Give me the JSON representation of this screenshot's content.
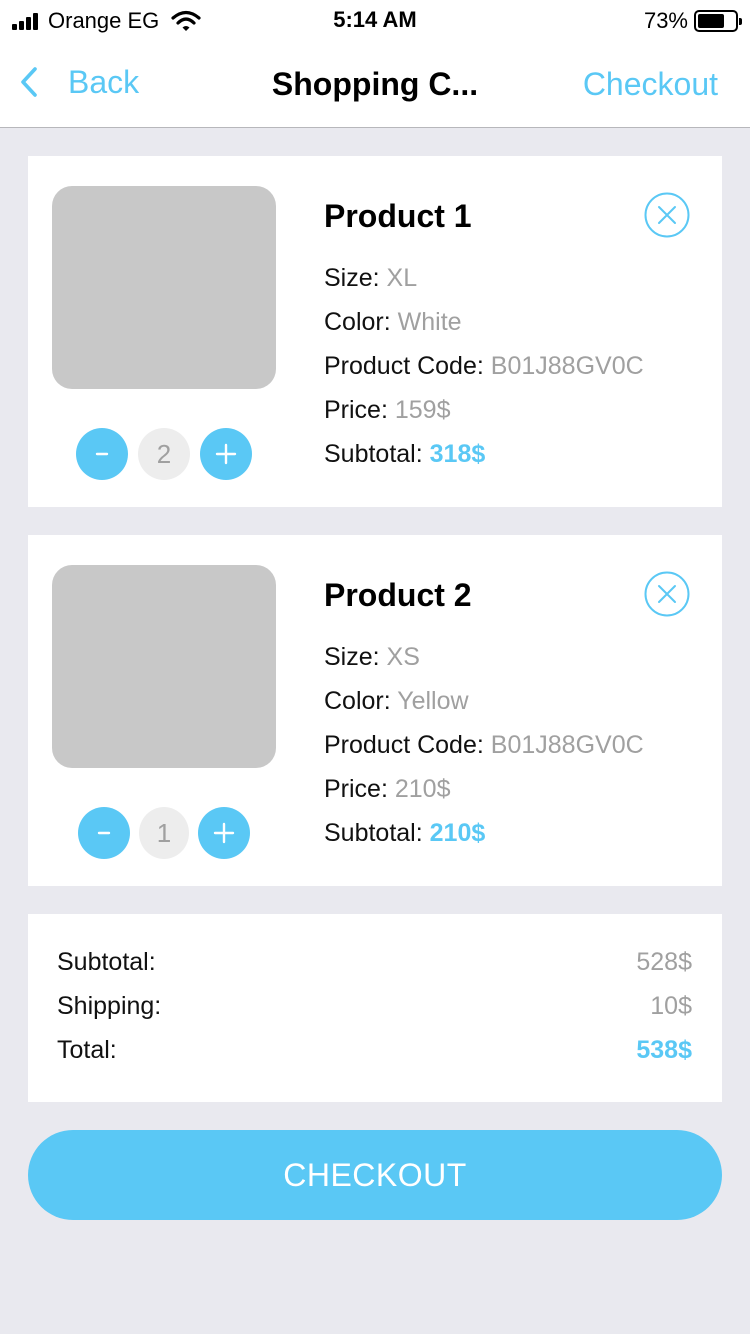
{
  "colors": {
    "accent": "#5ac8f5",
    "background": "#e9e9ef",
    "muted_text": "#a0a0a0",
    "image_placeholder": "#c8c8c8"
  },
  "status_bar": {
    "carrier": "Orange EG",
    "time": "5:14 AM",
    "battery_percent": "73%",
    "battery_level": 0.73,
    "icons": [
      "signal-icon",
      "wifi-icon",
      "battery-icon"
    ]
  },
  "nav": {
    "back_label": "Back",
    "title": "Shopping C...",
    "checkout_label": "Checkout"
  },
  "products": [
    {
      "name": "Product 1",
      "quantity": "2",
      "size_label": "Size:",
      "size": "XL",
      "color_label": "Color:",
      "color": "White",
      "code_label": "Product Code:",
      "code": "B01J88GV0C",
      "price_label": "Price:",
      "price": "159$",
      "subtotal_label": "Subtotal:",
      "subtotal": "318$"
    },
    {
      "name": "Product 2",
      "quantity": "1",
      "size_label": "Size:",
      "size": "XS",
      "color_label": "Color:",
      "color": "Yellow",
      "code_label": "Product Code:",
      "code": "B01J88GV0C",
      "price_label": "Price:",
      "price": "210$",
      "subtotal_label": "Subtotal:",
      "subtotal": "210$"
    }
  ],
  "summary": {
    "subtotal_label": "Subtotal:",
    "subtotal": "528$",
    "shipping_label": "Shipping:",
    "shipping": "10$",
    "total_label": "Total:",
    "total": "538$"
  },
  "checkout_button": {
    "label": "CHECKOUT"
  }
}
